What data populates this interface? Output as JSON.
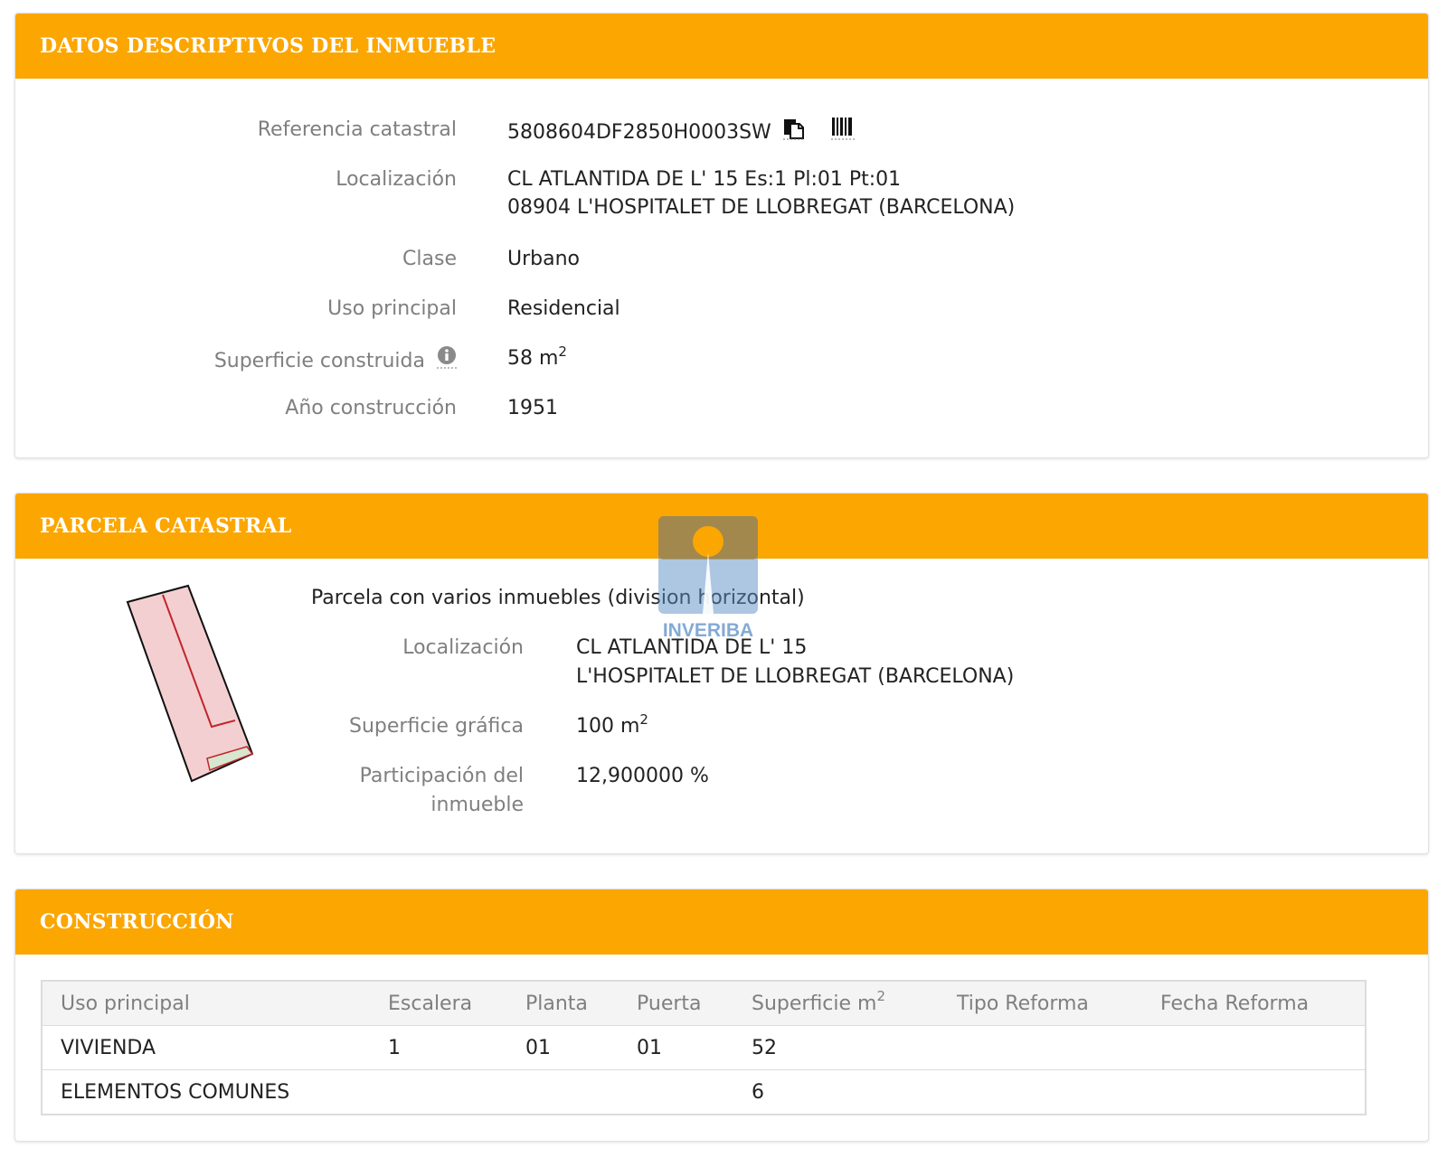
{
  "datos": {
    "title": "DATOS DESCRIPTIVOS DEL INMUEBLE",
    "referencia_label": "Referencia catastral",
    "referencia_value": "5808604DF2850H0003SW",
    "localizacion_label": "Localización",
    "localizacion_line1": "CL ATLANTIDA DE L' 15 Es:1 Pl:01 Pt:01",
    "localizacion_line2": "08904 L'HOSPITALET DE LLOBREGAT (BARCELONA)",
    "clase_label": "Clase",
    "clase_value": "Urbano",
    "uso_label": "Uso principal",
    "uso_value": "Residencial",
    "superficie_label": "Superficie construida",
    "superficie_value": "58 m",
    "superficie_exp": "2",
    "anio_label": "Año construcción",
    "anio_value": "1951",
    "icons": [
      "copy-icon",
      "barcode-icon",
      "info-icon"
    ]
  },
  "parcela": {
    "title": "PARCELA CATASTRAL",
    "description": "Parcela con varios inmuebles (division horizontal)",
    "localizacion_label": "Localización",
    "localizacion_line1": "CL ATLANTIDA DE L' 15",
    "localizacion_line2": "L'HOSPITALET DE LLOBREGAT (BARCELONA)",
    "superficie_label": "Superficie gráfica",
    "superficie_value": "100 m",
    "superficie_exp": "2",
    "participacion_label_line1": "Participación del",
    "participacion_label_line2": "inmueble",
    "participacion_value": "12,900000 %"
  },
  "construccion": {
    "title": "CONSTRUCCIÓN",
    "headers": {
      "uso": "Uso principal",
      "escalera": "Escalera",
      "planta": "Planta",
      "puerta": "Puerta",
      "superficie": "Superficie m",
      "superficie_exp": "2",
      "tipo_reforma": "Tipo Reforma",
      "fecha_reforma": "Fecha Reforma"
    },
    "rows": [
      {
        "uso": "VIVIENDA",
        "escalera": "1",
        "planta": "01",
        "puerta": "01",
        "superficie": "52",
        "tipo_reforma": "",
        "fecha_reforma": ""
      },
      {
        "uso": "ELEMENTOS COMUNES",
        "escalera": "",
        "planta": "",
        "puerta": "",
        "superficie": "6",
        "tipo_reforma": "",
        "fecha_reforma": ""
      }
    ]
  },
  "watermark": {
    "text": "INVERIBA"
  },
  "colors": {
    "header": "#fca602",
    "label": "#7f7f7f",
    "value": "#222222",
    "parcel_fill": "#f4cfd1",
    "parcel_stroke": "#c0262d",
    "watermark": "#5b8ec6"
  }
}
